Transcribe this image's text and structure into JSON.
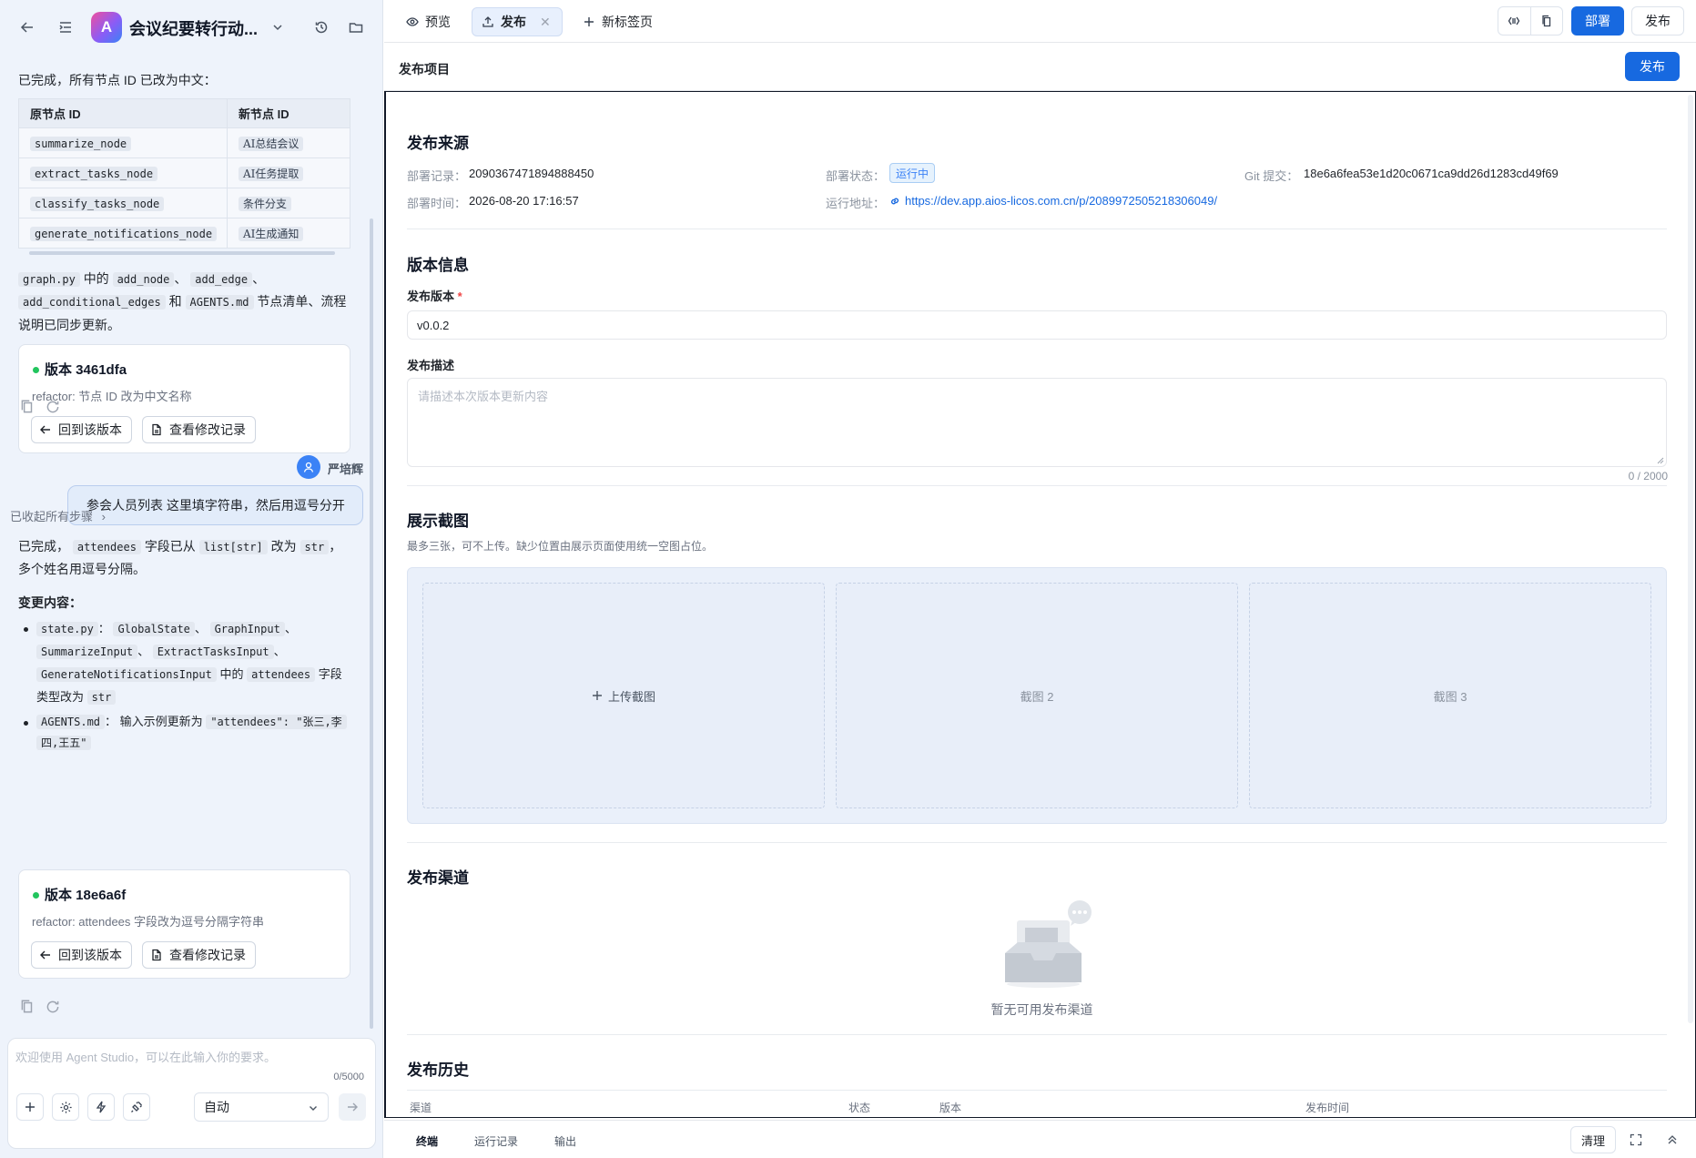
{
  "app": {
    "avatar_letter": "A",
    "title": "会议纪要转行动..."
  },
  "chat": {
    "msg1_intro": "已完成，所有节点 ID 已改为中文：",
    "table": {
      "headers": [
        "原节点 ID",
        "新节点 ID"
      ],
      "rows": [
        [
          "summarize_node",
          "AI总结会议"
        ],
        [
          "extract_tasks_node",
          "AI任务提取"
        ],
        [
          "classify_tasks_node",
          "条件分支"
        ],
        [
          "generate_notifications_node",
          "AI生成通知"
        ]
      ]
    },
    "msg1_tail": {
      "graph_py": "graph.py",
      "t_in": "中的",
      "add_node": "add_node",
      "sep1": "、",
      "add_edge": "add_edge",
      "sep2": "、",
      "add_cond": "add_conditional_edges",
      "t_and": "和",
      "agents_md": "AGENTS.md",
      "t_rest": "节点清单、流程",
      "line3": "说明已同步更新。"
    },
    "version1": {
      "title": "版本 3461dfa",
      "desc": "refactor: 节点 ID 改为中文名称",
      "btn_back": "回到该版本",
      "btn_log": "查看修改记录"
    },
    "user": {
      "name": "严培辉",
      "message": "参会人员列表 这里填字符串，然后用逗号分开"
    },
    "collapsed_steps": "已收起所有步骤",
    "msg2": {
      "p1_a": "已完成，",
      "p1_attendees": "attendees",
      "p1_b": "字段已从",
      "p1_list": "list[str]",
      "p1_c": "改为",
      "p1_str": "str",
      "p1_d": "，",
      "p1_line2": "多个姓名用逗号分隔。",
      "changes_title": "变更内容：",
      "b1_file": "state.py",
      "b1_colon": "：",
      "b1_c1": "GlobalState",
      "b1_s1": "、",
      "b1_c2": "GraphInput",
      "b1_s2": "、",
      "b1_c3": "SummarizeInput",
      "b1_s3": "、",
      "b1_c4": "ExtractTasksInput",
      "b1_s4": "、",
      "b1_c5": "GenerateNotificationsInput",
      "b1_in": "中的",
      "b1_c6": "attendees",
      "b1_field": "字段",
      "b1_type": "类型改为",
      "b1_c7": "str",
      "b2_file": "AGENTS.md",
      "b2_colon": "：",
      "b2_text": "输入示例更新为",
      "b2_code1": "\"attendees\": \"张三,李",
      "b2_code2": "四,王五\""
    },
    "version2": {
      "title": "版本 18e6a6f",
      "desc": "refactor: attendees 字段改为逗号分隔字符串",
      "btn_back": "回到该版本",
      "btn_log": "查看修改记录"
    }
  },
  "composer": {
    "placeholder": "欢迎使用 Agent Studio，可以在此输入你的要求。",
    "count": "0/5000",
    "mode": "自动"
  },
  "tabs": [
    {
      "label": "预览"
    },
    {
      "label": "发布"
    },
    {
      "label": "新标签页"
    }
  ],
  "toolbar": {
    "deploy": "部署",
    "publish": "发布"
  },
  "project": {
    "title": "发布项目",
    "publish_btn": "发布"
  },
  "source": {
    "title": "发布来源",
    "deploy_record_label": "部署记录：",
    "deploy_record": "2090367471894888450",
    "deploy_status_label": "部署状态：",
    "deploy_status": "运行中",
    "git_label": "Git 提交：",
    "git_commit": "18e6a6fea53e1d20c0671ca9dd26d1283cd49f69",
    "deploy_time_label": "部署时间：",
    "deploy_time": "2026-08-20 17:16:57",
    "run_url_label": "运行地址：",
    "run_url": "https://dev.app.aios-licos.com.cn/p/2089972505218306049/"
  },
  "version_info": {
    "title": "版本信息",
    "version_label": "发布版本",
    "required_mark": "*",
    "version_value": "v0.0.2",
    "desc_label": "发布描述",
    "desc_placeholder": "请描述本次版本更新内容",
    "desc_count": "0 / 2000"
  },
  "screenshots": {
    "title": "展示截图",
    "hint": "最多三张，可不上传。缺少位置由展示页面使用统一空图占位。",
    "upload": "上传截图",
    "slot2": "截图 2",
    "slot3": "截图 3"
  },
  "channels": {
    "title": "发布渠道",
    "empty": "暂无可用发布渠道"
  },
  "history": {
    "title": "发布历史",
    "columns": [
      "渠道",
      "状态",
      "版本",
      "发布时间"
    ]
  },
  "bottom": {
    "tabs": [
      "终端",
      "运行记录",
      "输出"
    ],
    "clear": "清理"
  },
  "colors": {
    "primary": "#1769e0",
    "status_tag": "#3b82f6",
    "success_dot": "#22c55e"
  }
}
